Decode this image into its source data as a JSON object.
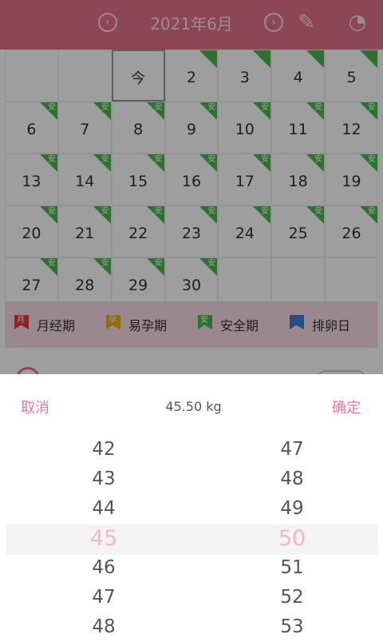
{
  "header": {
    "title": "2021年6月",
    "prev_icon": "‹",
    "next_icon": "›",
    "edit_icon": "✎",
    "stats_icon": "◔"
  },
  "calendar": {
    "rows": [
      [
        {
          "day": ""
        },
        {
          "day": ""
        },
        {
          "day": "今",
          "today": true
        },
        {
          "day": "2",
          "flag": ""
        },
        {
          "day": "3",
          "flag": ""
        },
        {
          "day": "4",
          "flag": ""
        },
        {
          "day": "5",
          "flag": ""
        }
      ],
      [
        {
          "day": "6",
          "flag": "安"
        },
        {
          "day": "7",
          "flag": "安"
        },
        {
          "day": "8",
          "flag": "安"
        },
        {
          "day": "9",
          "flag": "安"
        },
        {
          "day": "10",
          "flag": "安"
        },
        {
          "day": "11",
          "flag": "安"
        },
        {
          "day": "12",
          "flag": "安"
        }
      ],
      [
        {
          "day": "13",
          "flag": "安"
        },
        {
          "day": "14",
          "flag": "安"
        },
        {
          "day": "15",
          "flag": "安"
        },
        {
          "day": "16",
          "flag": "安"
        },
        {
          "day": "17",
          "flag": "安"
        },
        {
          "day": "18",
          "flag": "安"
        },
        {
          "day": "19",
          "flag": "安"
        }
      ],
      [
        {
          "day": "20",
          "flag": "安"
        },
        {
          "day": "21",
          "flag": "安"
        },
        {
          "day": "22",
          "flag": "安"
        },
        {
          "day": "23",
          "flag": "安"
        },
        {
          "day": "24",
          "flag": "安"
        },
        {
          "day": "25",
          "flag": "安"
        },
        {
          "day": "26",
          "flag": "安"
        }
      ],
      [
        {
          "day": "27",
          "flag": "安"
        },
        {
          "day": "28",
          "flag": "安"
        },
        {
          "day": "29",
          "flag": "安"
        },
        {
          "day": "30",
          "flag": "安"
        },
        {
          "day": ""
        },
        {
          "day": ""
        },
        {
          "day": ""
        }
      ]
    ],
    "flag_color": "#45b84a"
  },
  "legend": [
    {
      "label": "月经期",
      "mark": "月",
      "color": "#e04040"
    },
    {
      "label": "易孕期",
      "mark": "孕",
      "color": "#e6b400"
    },
    {
      "label": "安全期",
      "mark": "安",
      "color": "#45b84a"
    },
    {
      "label": "排卵日",
      "mark": "",
      "color": "#3f7fd6"
    }
  ],
  "picker": {
    "cancel_label": "取消",
    "confirm_label": "确定",
    "value_display": "45.50 kg",
    "left_column": [
      "42",
      "43",
      "44",
      "45",
      "46",
      "47",
      "48"
    ],
    "right_column": [
      "47",
      "48",
      "49",
      "50",
      "51",
      "52",
      "53"
    ],
    "selected_left": "45",
    "selected_right": "50",
    "accent_color": "#e9799a"
  }
}
